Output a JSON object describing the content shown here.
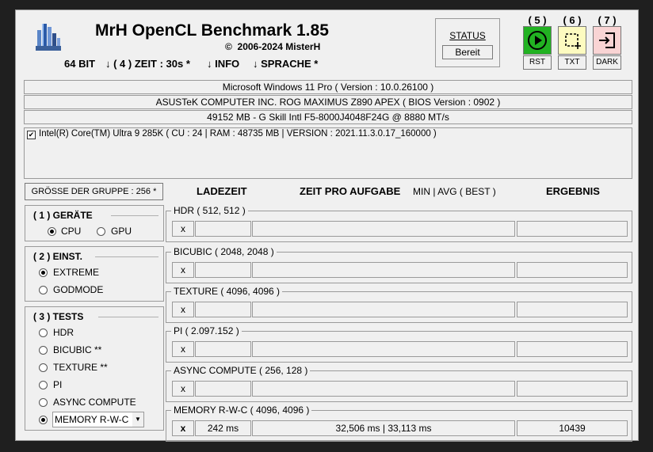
{
  "header": {
    "title": "MrH OpenCL Benchmark 1.85",
    "copyright_symbol": "©",
    "copyright": "2006-2024 MisterH",
    "menu": {
      "bit": "64 BIT",
      "zeit": "↓ ( 4 ) ZEIT : 30s *",
      "info": "↓ INFO",
      "sprache": "↓ SPRACHE *"
    }
  },
  "status": {
    "label": "STATUS",
    "value": "Bereit"
  },
  "buttons": [
    {
      "number": "( 5 )",
      "label": "RST",
      "icon": "play-icon",
      "color": "#22b222"
    },
    {
      "number": "( 6 )",
      "label": "TXT",
      "icon": "crop-icon",
      "color": "#fdfbc0"
    },
    {
      "number": "( 7 )",
      "label": "DARK",
      "icon": "sign-in-icon",
      "color": "#f9d4d4"
    }
  ],
  "system": {
    "os": "Microsoft Windows 11 Pro ( Version : 10.0.26100 )",
    "board": "ASUSTeK COMPUTER INC. ROG MAXIMUS Z890 APEX ( BIOS Version : 0902 )",
    "memory": "49152 MB - G Skill Intl F5-8000J4048F24G     @ 8880 MT/s"
  },
  "device": {
    "checked": true,
    "text": "Intel(R) Core(TM) Ultra 9 285K ( CU : 24 | RAM : 48735 MB | VERSION : 2021.11.3.0.17_160000 )"
  },
  "group_size": "GRÖSSE DER GRUPPE : 256 *",
  "columns": {
    "ladezeit": "LADEZEIT",
    "zeit": "ZEIT PRO AUFGABE",
    "minavg": "MIN | AVG ( BEST )",
    "ergebnis": "ERGEBNIS"
  },
  "geraete": {
    "title": "( 1 ) GERÄTE",
    "options": [
      "CPU",
      "GPU"
    ],
    "selected": "CPU"
  },
  "einst": {
    "title": "( 2 ) EINST.",
    "options": [
      "EXTREME",
      "GODMODE"
    ],
    "selected": "EXTREME"
  },
  "tests_panel": {
    "title": "( 3 ) TESTS",
    "options": [
      "HDR",
      "BICUBIC **",
      "TEXTURE **",
      "PI",
      "ASYNC COMPUTE",
      "MEMORY R-W-C"
    ],
    "selected": "MEMORY R-W-C"
  },
  "tests": [
    {
      "title": "HDR ( 512, 512 )",
      "x": "x",
      "load": "",
      "time": "",
      "result": ""
    },
    {
      "title": "BICUBIC ( 2048, 2048 )",
      "x": "x",
      "load": "",
      "time": "",
      "result": ""
    },
    {
      "title": "TEXTURE ( 4096, 4096 )",
      "x": "x",
      "load": "",
      "time": "",
      "result": ""
    },
    {
      "title": "PI ( 2.097.152 )",
      "x": "x",
      "load": "",
      "time": "",
      "result": ""
    },
    {
      "title": "ASYNC COMPUTE ( 256, 128 )",
      "x": "x",
      "load": "",
      "time": "",
      "result": ""
    },
    {
      "title": "MEMORY R-W-C ( 4096, 4096 )",
      "x": "x",
      "load": "242 ms",
      "time": "32,506 ms | 33,113 ms",
      "result": "10439"
    }
  ]
}
